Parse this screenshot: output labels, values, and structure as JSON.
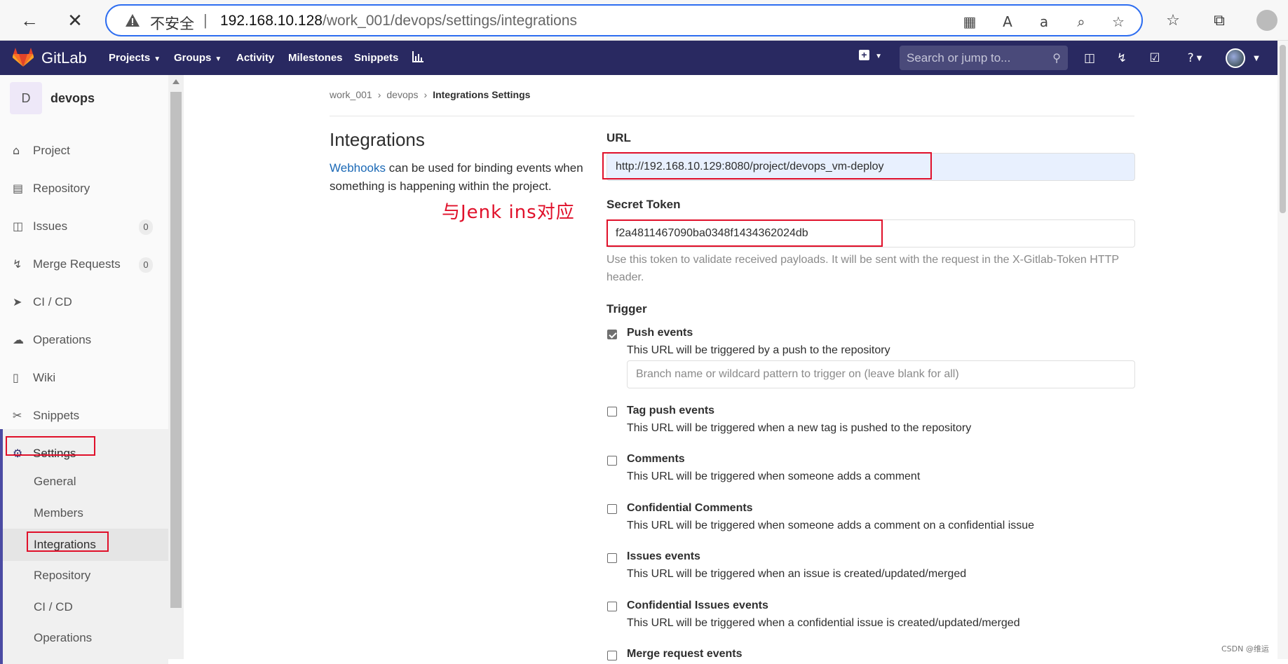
{
  "browser": {
    "insecure_label": "不安全",
    "url_host": "192.168.10.128",
    "url_path": "/work_001/devops/settings/integrations"
  },
  "header": {
    "brand": "GitLab",
    "nav": [
      "Projects",
      "Groups",
      "Activity",
      "Milestones",
      "Snippets"
    ],
    "search_placeholder": "Search or jump to..."
  },
  "sidebar": {
    "project_initial": "D",
    "project_name": "devops",
    "items": [
      {
        "label": "Project",
        "icon": "home-icon"
      },
      {
        "label": "Repository",
        "icon": "doc-icon"
      },
      {
        "label": "Issues",
        "icon": "issues-icon",
        "badge": "0"
      },
      {
        "label": "Merge Requests",
        "icon": "merge-icon",
        "badge": "0"
      },
      {
        "label": "CI / CD",
        "icon": "rocket-icon"
      },
      {
        "label": "Operations",
        "icon": "cloud-gear-icon"
      },
      {
        "label": "Wiki",
        "icon": "book-icon"
      },
      {
        "label": "Snippets",
        "icon": "scissors-icon"
      },
      {
        "label": "Settings",
        "icon": "gear-icon"
      }
    ],
    "sub_items": [
      "General",
      "Members",
      "Integrations",
      "Repository",
      "CI / CD",
      "Operations"
    ]
  },
  "breadcrumb": [
    "work_001",
    "devops",
    "Integrations Settings"
  ],
  "section": {
    "title": "Integrations",
    "desc_link": "Webhooks",
    "desc_rest": " can be used for binding events when something is happening within the project.",
    "annotation": "与Jenk ins对应"
  },
  "form": {
    "url_label": "URL",
    "url_value": "http://192.168.10.129:8080/project/devops_vm-deploy",
    "token_label": "Secret Token",
    "token_value": "f2a4811467090ba0348f1434362024db",
    "token_help": "Use this token to validate received payloads. It will be sent with the request in the X-Gitlab-Token HTTP header.",
    "trigger_label": "Trigger",
    "branch_placeholder": "Branch name or wildcard pattern to trigger on (leave blank for all)",
    "triggers": [
      {
        "name": "Push events",
        "desc": "This URL will be triggered by a push to the repository",
        "checked": true
      },
      {
        "name": "Tag push events",
        "desc": "This URL will be triggered when a new tag is pushed to the repository",
        "checked": false
      },
      {
        "name": "Comments",
        "desc": "This URL will be triggered when someone adds a comment",
        "checked": false
      },
      {
        "name": "Confidential Comments",
        "desc": "This URL will be triggered when someone adds a comment on a confidential issue",
        "checked": false
      },
      {
        "name": "Issues events",
        "desc": "This URL will be triggered when an issue is created/updated/merged",
        "checked": false
      },
      {
        "name": "Confidential Issues events",
        "desc": "This URL will be triggered when a confidential issue is created/updated/merged",
        "checked": false
      },
      {
        "name": "Merge request events",
        "desc": "",
        "checked": false
      }
    ]
  },
  "watermark": "CSDN @维运"
}
